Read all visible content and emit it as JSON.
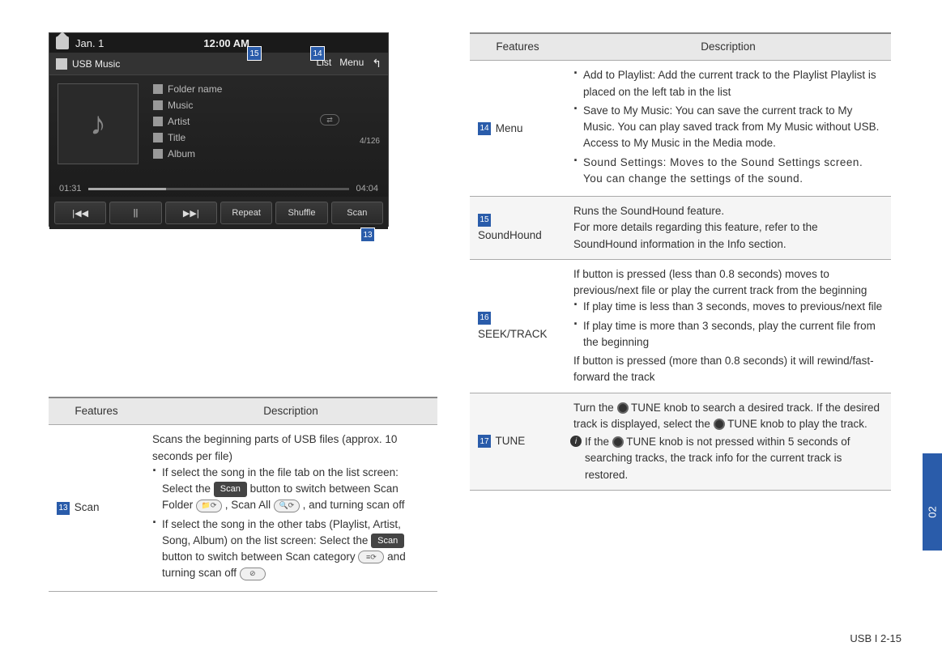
{
  "screenshot": {
    "date": "Jan. 1",
    "time": "12:00 AM",
    "title": "USB Music",
    "tabs": {
      "list": "List",
      "menu": "Menu"
    },
    "meta": {
      "folder": "Folder name",
      "music": "Music",
      "artist": "Artist",
      "title": "Title",
      "album": "Album"
    },
    "counter": "4/126",
    "elapsed": "01:31",
    "duration": "04:04",
    "controls": {
      "prev": "|◀◀",
      "pause": "||",
      "next": "▶▶|",
      "repeat": "Repeat",
      "shuffle": "Shuffle",
      "scan": "Scan"
    },
    "callouts": {
      "c15": "15",
      "c14": "14",
      "c13": "13"
    }
  },
  "leftTable": {
    "headers": {
      "features": "Features",
      "description": "Description"
    },
    "rows": [
      {
        "num": "13",
        "feature": "Scan",
        "intro": "Scans the beginning parts of USB files (approx. 10 seconds per file)",
        "b1_a": "If select the song in the file tab on the list screen: Select the ",
        "b1_btn": "Scan",
        "b1_b": " button to switch between Scan Folder ",
        "b1_c": ", Scan All ",
        "b1_d": ", and turning scan off",
        "b2_a": "If select the song in the other tabs (Playlist, Artist, Song, Album) on the list screen: Select the ",
        "b2_btn": "Scan",
        "b2_b": " button to switch between Scan category ",
        "b2_c": " and turning scan off "
      }
    ]
  },
  "rightTable": {
    "headers": {
      "features": "Features",
      "description": "Description"
    },
    "rows": {
      "menu": {
        "num": "14",
        "feature": "Menu",
        "b1": "Add to Playlist: Add the current track to the Playlist Playlist is placed on the left tab in the list",
        "b2": "Save to My Music: You can save the current track to My Music. You can play saved track from My Music without USB.  Access to My Music in the Media mode.",
        "b3": "Sound Settings: Moves to the Sound Settings screen. You can change the settings of the sound."
      },
      "soundhound": {
        "num": "15",
        "feature": "SoundHound",
        "p1": "Runs the SoundHound feature.",
        "p2": "For more details regarding this feature, refer to the SoundHound information in the Info section."
      },
      "seek": {
        "num": "16",
        "feature": "SEEK/TRACK",
        "p1": "If button is pressed (less than 0.8 seconds) moves to previous/next file or play the current track from the beginning",
        "b1": "If play time is less than 3 seconds, moves to previous/next file",
        "b2": "If play time is more than 3 seconds, play the current file from the beginning",
        "p2": "If button is pressed (more than 0.8 seconds) it will rewind/fast-forward the track"
      },
      "tune": {
        "num": "17",
        "feature": "TUNE",
        "p1a": "Turn the ",
        "p1_knob": "TUNE",
        "p1b": " knob to search a desired track. If the desired track is displayed, select the ",
        "p1c": " knob to play the track.",
        "info_a": "If the ",
        "info_knob": "TUNE",
        "info_b": " knob is not pressed within 5 seconds of searching tracks, the track info for the current track is restored."
      }
    }
  },
  "sideTab": "02",
  "footer": "USB I 2-15"
}
